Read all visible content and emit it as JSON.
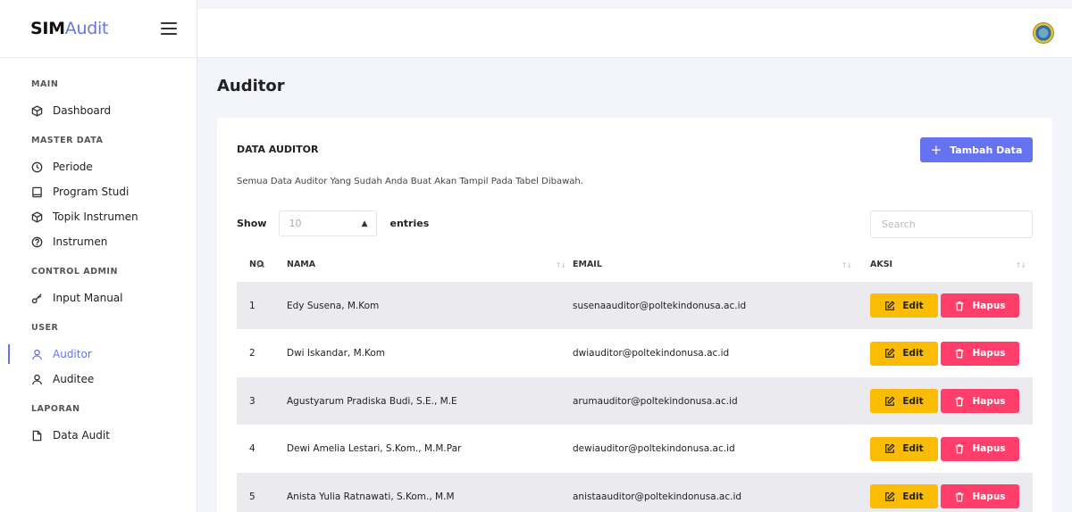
{
  "brand": {
    "bold": "SIM",
    "light": "Audit"
  },
  "colors": {
    "accent": "#6673f0",
    "edit": "#fbbc05",
    "delete": "#ff3e6b"
  },
  "sidebar": {
    "sections": [
      {
        "label": "MAIN",
        "items": [
          {
            "label": "Dashboard",
            "icon": "cube-icon"
          }
        ]
      },
      {
        "label": "MASTER DATA",
        "items": [
          {
            "label": "Periode",
            "icon": "clock-icon"
          },
          {
            "label": "Program Studi",
            "icon": "book-icon"
          },
          {
            "label": "Topik Instrumen",
            "icon": "cube-icon"
          },
          {
            "label": "Instrumen",
            "icon": "question-circle-icon"
          }
        ]
      },
      {
        "label": "CONTROL ADMIN",
        "items": [
          {
            "label": "Input Manual",
            "icon": "key-icon"
          }
        ]
      },
      {
        "label": "USER",
        "items": [
          {
            "label": "Auditor",
            "icon": "user-icon",
            "active": true
          },
          {
            "label": "Auditee",
            "icon": "user-icon"
          }
        ]
      },
      {
        "label": "LAPORAN",
        "items": [
          {
            "label": "Data Audit",
            "icon": "file-icon"
          }
        ]
      }
    ]
  },
  "page": {
    "title": "Auditor"
  },
  "card": {
    "title": "DATA AUDITOR",
    "add_label": "Tambah Data",
    "description": "Semua Data Auditor Yang Sudah Anda Buat Akan Tampil Pada Tabel Dibawah.",
    "show_label": "Show",
    "entries_value": "10",
    "entries_label": "entries",
    "search_placeholder": "Search"
  },
  "table": {
    "headers": {
      "no": "NO",
      "nama": "NAMA",
      "email": "EMAIL",
      "aksi": "AKSI"
    },
    "edit_label": "Edit",
    "delete_label": "Hapus",
    "rows": [
      {
        "no": "1",
        "nama": "Edy Susena, M.Kom",
        "email": "susenaauditor@poltekindonusa.ac.id"
      },
      {
        "no": "2",
        "nama": "Dwi Iskandar, M.Kom",
        "email": "dwiauditor@poltekindonusa.ac.id"
      },
      {
        "no": "3",
        "nama": "Agustyarum Pradiska Budi, S.E., M.E",
        "email": "arumauditor@poltekindonusa.ac.id"
      },
      {
        "no": "4",
        "nama": "Dewi Amelia Lestari, S.Kom., M.M.Par",
        "email": "dewiauditor@poltekindonusa.ac.id"
      },
      {
        "no": "5",
        "nama": "Anista Yulia Ratnawati, S.Kom., M.M",
        "email": "anistaauditor@poltekindonusa.ac.id"
      }
    ]
  }
}
